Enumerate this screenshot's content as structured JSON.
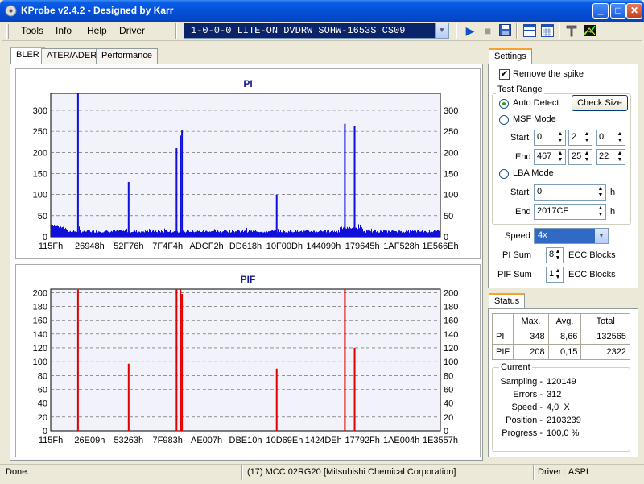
{
  "window": {
    "title": "KProbe v2.4.2 - Designed by Karr",
    "min": "_",
    "max": "□",
    "close": "✕"
  },
  "menu": [
    "Tools",
    "Info",
    "Help",
    "Driver"
  ],
  "drive": {
    "selected": "1-0-0-0 LITE-ON DVDRW SOHW-1653S CS09"
  },
  "toolbar_icons": [
    "play-icon",
    "stop-icon",
    "save-icon",
    "layout-icon",
    "calendar-icon",
    "tools-icon",
    "chart-icon"
  ],
  "tabs": [
    "BLER",
    "ATER/ADER",
    "Performance"
  ],
  "active_tab": "BLER",
  "pi_chart": {
    "title": "PI",
    "yticks": [
      "0",
      "50",
      "100",
      "150",
      "200",
      "250",
      "300"
    ],
    "xticks": [
      "115Fh",
      "26948h",
      "52F76h",
      "7F4F4h",
      "ADCF2h",
      "DD618h",
      "10F00Dh",
      "144099h",
      "179645h",
      "1AF528h",
      "1E566Eh"
    ]
  },
  "pif_chart": {
    "title": "PIF",
    "yticks": [
      "0",
      "20",
      "40",
      "60",
      "80",
      "100",
      "120",
      "140",
      "160",
      "180",
      "200"
    ],
    "xticks": [
      "115Fh",
      "26E09h",
      "53263h",
      "7F983h",
      "AE007h",
      "DBE10h",
      "10D69Eh",
      "1424DEh",
      "17792Fh",
      "1AE004h",
      "1E3557h"
    ]
  },
  "chart_data": [
    {
      "type": "bar",
      "title": "PI",
      "ylim": [
        0,
        340
      ],
      "xlim": [
        0,
        1
      ],
      "baseline_noise": "approx 10-30 across entire range",
      "spikes": [
        {
          "x": 0.07,
          "y": 348
        },
        {
          "x": 0.2,
          "y": 130
        },
        {
          "x": 0.323,
          "y": 210
        },
        {
          "x": 0.333,
          "y": 240
        },
        {
          "x": 0.337,
          "y": 252
        },
        {
          "x": 0.58,
          "y": 100
        },
        {
          "x": 0.755,
          "y": 268
        },
        {
          "x": 0.78,
          "y": 262
        }
      ],
      "colors": {
        "bars": "#1010d8",
        "grid": "#555555"
      }
    },
    {
      "type": "bar",
      "title": "PIF",
      "ylim": [
        0,
        205
      ],
      "spikes": [
        {
          "x": 0.07,
          "y": 204
        },
        {
          "x": 0.2,
          "y": 97
        },
        {
          "x": 0.323,
          "y": 208
        },
        {
          "x": 0.333,
          "y": 205
        },
        {
          "x": 0.337,
          "y": 198
        },
        {
          "x": 0.58,
          "y": 90
        },
        {
          "x": 0.755,
          "y": 206
        },
        {
          "x": 0.78,
          "y": 120
        }
      ],
      "colors": {
        "bars": "#e00000",
        "grid": "#555555"
      }
    }
  ],
  "settings": {
    "tab_label": "Settings",
    "remove_spike_label": "Remove the spike",
    "remove_spike_checked": true,
    "test_range_label": "Test Range",
    "auto_detect_label": "Auto Detect",
    "check_size_label": "Check Size",
    "msf_mode_label": "MSF Mode",
    "start_label": "Start",
    "end_label": "End",
    "msf_start": [
      "0",
      "2",
      "0"
    ],
    "msf_end": [
      "467",
      "25",
      "22"
    ],
    "lba_mode_label": "LBA Mode",
    "lba_start": "0",
    "lba_end": "2017CF",
    "h_unit": "h",
    "speed_label": "Speed",
    "speed_value": "4x",
    "pi_sum_label": "PI Sum",
    "pi_sum_value": "8",
    "pif_sum_label": "PIF Sum",
    "pif_sum_value": "1",
    "ecc_blocks_label": "ECC Blocks"
  },
  "status": {
    "tab_label": "Status",
    "headers": [
      "",
      "Max.",
      "Avg.",
      "Total"
    ],
    "rows": [
      [
        "PI",
        "348",
        "8,66",
        "132565"
      ],
      [
        "PIF",
        "208",
        "0,15",
        "2322"
      ]
    ],
    "current_label": "Current",
    "sampling_label": "Sampling -",
    "sampling_value": "120149",
    "errors_label": "Errors -",
    "errors_value": "312",
    "speed_label": "Speed -",
    "speed_value": "4,0  X",
    "position_label": "Position -",
    "position_value": "2103239",
    "progress_label": "Progress -",
    "progress_value": "100,0 %"
  },
  "statusbar": {
    "left": "Done.",
    "disc": "(17) MCC 02RG20",
    "manufacturer": "[Mitsubishi Chemical Corporation]",
    "driver": "Driver : ASPI"
  }
}
